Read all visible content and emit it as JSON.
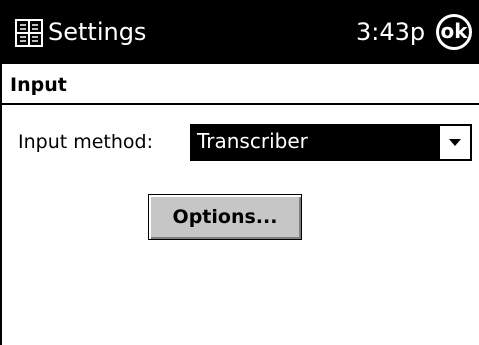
{
  "titlebar": {
    "start_icon": "windows-flag-icon",
    "title": "Settings",
    "clock": "3:43p",
    "ok_label": "ok"
  },
  "section": {
    "title": "Input"
  },
  "form": {
    "input_method_label": "Input method:",
    "input_method_value": "Transcriber",
    "dropdown_icon": "chevron-down-icon",
    "options_button_label": "Options..."
  },
  "colors": {
    "titlebar_bg": "#000000",
    "titlebar_text": "#ffffff",
    "button_face": "#c6c6c6",
    "selected_bg": "#000000",
    "selected_text": "#ffffff"
  }
}
